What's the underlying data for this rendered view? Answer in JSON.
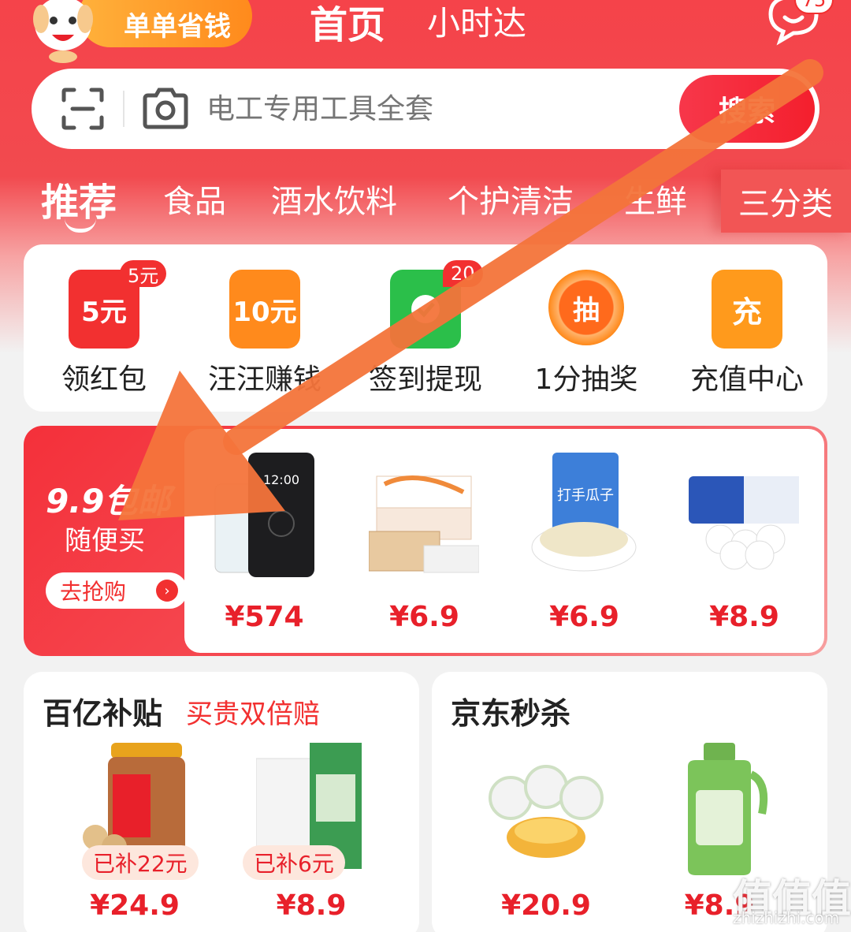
{
  "header": {
    "promo_pill": "单单省钱",
    "tab_home": "首页",
    "tab_hour": "小时达",
    "message_badge": "75"
  },
  "search": {
    "placeholder": "电工专用工具全套",
    "button_label": "搜索"
  },
  "categories": {
    "items": [
      "推荐",
      "食品",
      "酒水饮料",
      "个护清洁",
      "生鲜"
    ],
    "all_label": "三分类"
  },
  "quick_entries": [
    {
      "label": "领红包",
      "icon_text": "5元",
      "badge": "5元",
      "color": "#f23030",
      "icon": "red-packet-icon"
    },
    {
      "label": "汪汪赚钱",
      "icon_text": "10元",
      "badge": "",
      "color": "#ff8a1c",
      "icon": "coin-envelope-icon"
    },
    {
      "label": "签到提现",
      "icon_text": "",
      "badge": "20",
      "color": "#2bbf4a",
      "icon": "checkin-icon"
    },
    {
      "label": "1分抽奖",
      "icon_text": "抽",
      "badge": "",
      "color": "#ff6a1c",
      "icon": "lottery-icon"
    },
    {
      "label": "充值中心",
      "icon_text": "充",
      "badge": "",
      "color": "#ff9a1c",
      "icon": "recharge-icon"
    }
  ],
  "banner": {
    "title": "9.9包邮",
    "subtitle": "随便买",
    "button": "去抢购",
    "goods": [
      {
        "price": "¥574",
        "icon": "phone-product-icon",
        "text": "12:00"
      },
      {
        "price": "¥6.9",
        "icon": "tissue-box-product-icon"
      },
      {
        "price": "¥6.9",
        "icon": "sunflower-seeds-product-icon",
        "text": "打手瓜子"
      },
      {
        "price": "¥8.9",
        "icon": "toilet-paper-product-icon"
      }
    ]
  },
  "subsidy_card": {
    "title": "百亿补贴",
    "subtitle": "买贵双倍赔",
    "items": [
      {
        "tag": "已补22元",
        "price": "¥24.9",
        "icon": "macadamia-jar-product-icon"
      },
      {
        "tag": "已补6元",
        "price": "¥8.9",
        "icon": "paper-roll-product-icon"
      }
    ]
  },
  "seckill_card": {
    "title": "京东秒杀",
    "items": [
      {
        "price": "¥20.9",
        "icon": "pudding-cake-product-icon"
      },
      {
        "price": "¥8.9",
        "icon": "laundry-detergent-product-icon"
      }
    ]
  },
  "watermark": {
    "logo": "值值值",
    "url": "zhizhizhi.com"
  },
  "colors": {
    "brand_red": "#f23030",
    "arrow": "#f4743b",
    "price": "#e8202a"
  }
}
